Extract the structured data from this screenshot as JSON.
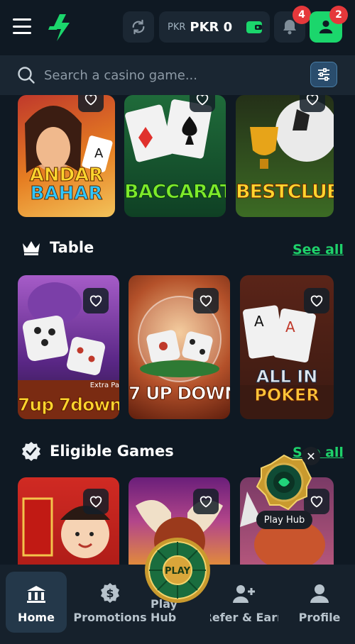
{
  "header": {
    "currency_code": "PKR",
    "balance": "PKR 0",
    "notifications_count": "4",
    "profile_count": "2"
  },
  "search": {
    "placeholder": "Search a casino game..."
  },
  "top_row": [
    {
      "title_line1": "ANDAR",
      "title_line2": "BAHAR"
    },
    {
      "title": "BACCARAT"
    },
    {
      "title": "BESTCLUB"
    }
  ],
  "sections": [
    {
      "title": "Table",
      "see_all": "See all",
      "games": [
        {
          "title": "7up 7down",
          "tag": "Extra Pa"
        },
        {
          "title": "7 UP DOWN"
        },
        {
          "title_line1": "ALL IN",
          "title_line2": "POKER"
        }
      ]
    },
    {
      "title": "Eligible Games",
      "see_all": "See all",
      "games": [
        {},
        {},
        {}
      ]
    }
  ],
  "play_hub_float": {
    "label": "Play Hub"
  },
  "play_wheel": {
    "label": "PLAY"
  },
  "bottom_nav": [
    {
      "label": "Home",
      "icon": "bank-icon"
    },
    {
      "label": "Promotions",
      "icon": "dollar-badge-icon"
    },
    {
      "label": "Play Hub",
      "icon": "play-wheel-icon"
    },
    {
      "label": "Refer & Earn",
      "icon": "add-user-icon"
    },
    {
      "label": "Profile",
      "icon": "user-icon"
    }
  ],
  "colors": {
    "accent": "#1bd66c",
    "background": "#0f1923",
    "badge": "#e5383b"
  }
}
